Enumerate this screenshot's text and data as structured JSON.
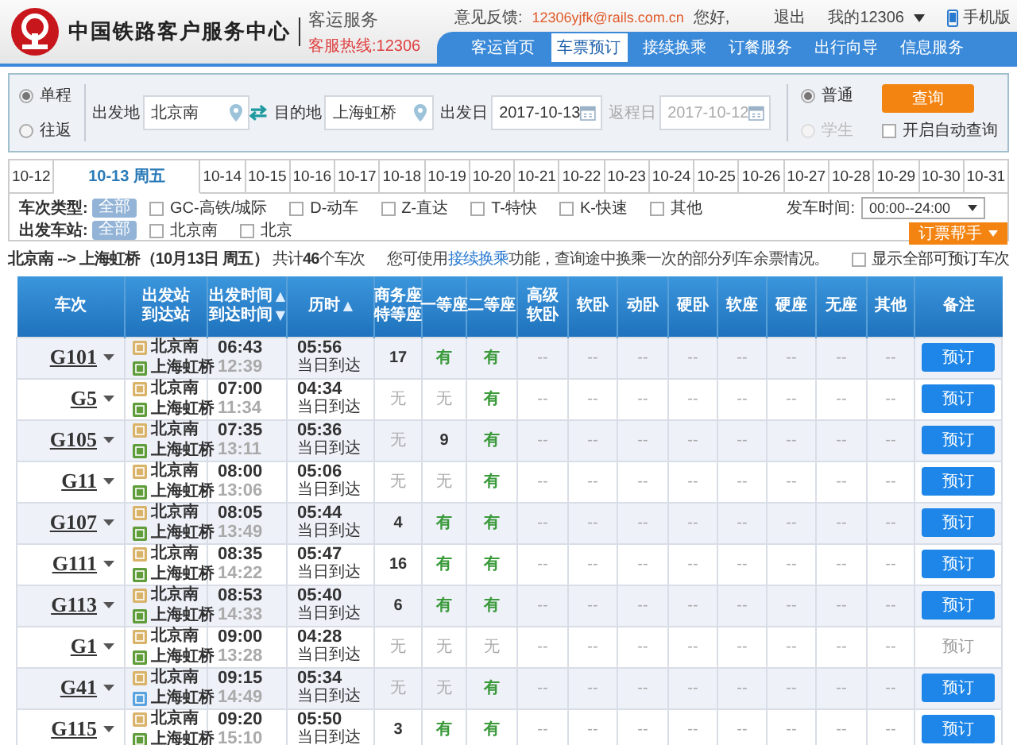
{
  "header": {
    "title": "中国铁路客户服务中心",
    "subtitle": "客运服务",
    "hotline": "客服热线:12306",
    "feedback_label": "意见反馈:",
    "feedback_email": "12306yjfk@rails.com.cn",
    "greeting": "您好,",
    "logout": "退出",
    "my_account": "我的12306",
    "mobile": "手机版",
    "nav": [
      {
        "label": "客运首页",
        "selected": false
      },
      {
        "label": "车票预订",
        "selected": true
      },
      {
        "label": "接续换乘",
        "selected": false
      },
      {
        "label": "订餐服务",
        "selected": false
      },
      {
        "label": "出行向导",
        "selected": false
      },
      {
        "label": "信息服务",
        "selected": false
      }
    ]
  },
  "search": {
    "trip_types": [
      {
        "label": "单程",
        "selected": true
      },
      {
        "label": "往返",
        "selected": false
      }
    ],
    "from": {
      "label": "出发地",
      "value": "北京南"
    },
    "to": {
      "label": "目的地",
      "value": "上海虹桥"
    },
    "depart_date": {
      "label": "出发日",
      "value": "2017-10-13",
      "disabled": false
    },
    "return_date": {
      "label": "返程日",
      "value": "2017-10-12",
      "disabled": true
    },
    "passenger_types": [
      {
        "label": "普通",
        "selected": true,
        "disabled": false
      },
      {
        "label": "学生",
        "selected": false,
        "disabled": true
      }
    ],
    "query_button": "查询",
    "auto_query": {
      "label": "开启自动查询",
      "checked": false
    }
  },
  "dates": [
    {
      "label": "10-12",
      "selected": false
    },
    {
      "label": "10-13 周五",
      "selected": true
    },
    {
      "label": "10-14",
      "selected": false
    },
    {
      "label": "10-15",
      "selected": false
    },
    {
      "label": "10-16",
      "selected": false
    },
    {
      "label": "10-17",
      "selected": false
    },
    {
      "label": "10-18",
      "selected": false
    },
    {
      "label": "10-19",
      "selected": false
    },
    {
      "label": "10-20",
      "selected": false
    },
    {
      "label": "10-21",
      "selected": false
    },
    {
      "label": "10-22",
      "selected": false
    },
    {
      "label": "10-23",
      "selected": false
    },
    {
      "label": "10-24",
      "selected": false
    },
    {
      "label": "10-25",
      "selected": false
    },
    {
      "label": "10-26",
      "selected": false
    },
    {
      "label": "10-27",
      "selected": false
    },
    {
      "label": "10-28",
      "selected": false
    },
    {
      "label": "10-29",
      "selected": false
    },
    {
      "label": "10-30",
      "selected": false
    },
    {
      "label": "10-31",
      "selected": false
    }
  ],
  "filters": {
    "train_type": {
      "label": "车次类型:",
      "all": {
        "label": "全部",
        "selected": true
      },
      "options": [
        {
          "label": "GC-高铁/城际",
          "checked": false
        },
        {
          "label": "D-动车",
          "checked": false
        },
        {
          "label": "Z-直达",
          "checked": false
        },
        {
          "label": "T-特快",
          "checked": false
        },
        {
          "label": "K-快速",
          "checked": false
        },
        {
          "label": "其他",
          "checked": false
        }
      ]
    },
    "depart_time": {
      "label": "发车时间:",
      "value": "00:00--24:00"
    },
    "station": {
      "label": "出发车站:",
      "all": {
        "label": "全部",
        "selected": true
      },
      "options": [
        {
          "label": "北京南",
          "checked": false
        },
        {
          "label": "北京",
          "checked": false
        }
      ]
    },
    "helper_button": "订票帮手"
  },
  "summary": {
    "route": "**北京南 --> 上海虹桥（10月13日  周五）** 共计**46**个车次",
    "notice_before": "您可使用",
    "notice_link": "接续换乘",
    "notice_after": "功能，查询途中换乘一次的部分列车余票情况。",
    "show_all": {
      "label": "显示全部可预订车次",
      "checked": false
    }
  },
  "table": {
    "columns": [
      {
        "lines": [
          {
            "text": "车次"
          }
        ]
      },
      {
        "lines": [
          {
            "text": "出发站"
          },
          {
            "text": "到达站"
          }
        ]
      },
      {
        "lines": [
          {
            "text": "出发时间",
            "sort": "▲"
          },
          {
            "text": "到达时间",
            "sort": "▼"
          }
        ]
      },
      {
        "lines": [
          {
            "text": "历时",
            "sort": "▲"
          }
        ]
      },
      {
        "lines": [
          {
            "text": "商务座"
          },
          {
            "text": "特等座"
          }
        ]
      },
      {
        "lines": [
          {
            "text": "一等座"
          }
        ]
      },
      {
        "lines": [
          {
            "text": "二等座"
          }
        ]
      },
      {
        "lines": [
          {
            "text": "高级"
          },
          {
            "text": "软卧"
          }
        ]
      },
      {
        "lines": [
          {
            "text": "软卧"
          }
        ]
      },
      {
        "lines": [
          {
            "text": "动卧"
          }
        ]
      },
      {
        "lines": [
          {
            "text": "硬卧"
          }
        ]
      },
      {
        "lines": [
          {
            "text": "软座"
          }
        ]
      },
      {
        "lines": [
          {
            "text": "硬座"
          }
        ]
      },
      {
        "lines": [
          {
            "text": "无座"
          }
        ]
      },
      {
        "lines": [
          {
            "text": "其他"
          }
        ]
      },
      {
        "lines": [
          {
            "text": "备注"
          }
        ]
      }
    ],
    "rows": [
      {
        "train": "G101",
        "from": {
          "name": "北京南",
          "kind": "start"
        },
        "to": {
          "name": "上海虹桥",
          "kind": "end"
        },
        "depart": "06:43",
        "arrive": "12:39",
        "duration": "05:56",
        "arrival_day": "当日到达",
        "seats": [
          {
            "text": "17",
            "kind": "count"
          },
          {
            "text": "有",
            "kind": "yes"
          },
          {
            "text": "有",
            "kind": "yes"
          },
          {
            "text": "--",
            "kind": "na"
          },
          {
            "text": "--",
            "kind": "na"
          },
          {
            "text": "--",
            "kind": "na"
          },
          {
            "text": "--",
            "kind": "na"
          },
          {
            "text": "--",
            "kind": "na"
          },
          {
            "text": "--",
            "kind": "na"
          },
          {
            "text": "--",
            "kind": "na"
          },
          {
            "text": "--",
            "kind": "na"
          }
        ],
        "book": {
          "label": "预订",
          "disabled": false
        }
      },
      {
        "train": "G5",
        "from": {
          "name": "北京南",
          "kind": "start"
        },
        "to": {
          "name": "上海虹桥",
          "kind": "end"
        },
        "depart": "07:00",
        "arrive": "11:34",
        "duration": "04:34",
        "arrival_day": "当日到达",
        "seats": [
          {
            "text": "无",
            "kind": "no"
          },
          {
            "text": "无",
            "kind": "no"
          },
          {
            "text": "有",
            "kind": "yes"
          },
          {
            "text": "--",
            "kind": "na"
          },
          {
            "text": "--",
            "kind": "na"
          },
          {
            "text": "--",
            "kind": "na"
          },
          {
            "text": "--",
            "kind": "na"
          },
          {
            "text": "--",
            "kind": "na"
          },
          {
            "text": "--",
            "kind": "na"
          },
          {
            "text": "--",
            "kind": "na"
          },
          {
            "text": "--",
            "kind": "na"
          }
        ],
        "book": {
          "label": "预订",
          "disabled": false
        }
      },
      {
        "train": "G105",
        "from": {
          "name": "北京南",
          "kind": "start"
        },
        "to": {
          "name": "上海虹桥",
          "kind": "end"
        },
        "depart": "07:35",
        "arrive": "13:11",
        "duration": "05:36",
        "arrival_day": "当日到达",
        "seats": [
          {
            "text": "无",
            "kind": "no"
          },
          {
            "text": "9",
            "kind": "count"
          },
          {
            "text": "有",
            "kind": "yes"
          },
          {
            "text": "--",
            "kind": "na"
          },
          {
            "text": "--",
            "kind": "na"
          },
          {
            "text": "--",
            "kind": "na"
          },
          {
            "text": "--",
            "kind": "na"
          },
          {
            "text": "--",
            "kind": "na"
          },
          {
            "text": "--",
            "kind": "na"
          },
          {
            "text": "--",
            "kind": "na"
          },
          {
            "text": "--",
            "kind": "na"
          }
        ],
        "book": {
          "label": "预订",
          "disabled": false
        }
      },
      {
        "train": "G11",
        "from": {
          "name": "北京南",
          "kind": "start"
        },
        "to": {
          "name": "上海虹桥",
          "kind": "end"
        },
        "depart": "08:00",
        "arrive": "13:06",
        "duration": "05:06",
        "arrival_day": "当日到达",
        "seats": [
          {
            "text": "无",
            "kind": "no"
          },
          {
            "text": "无",
            "kind": "no"
          },
          {
            "text": "有",
            "kind": "yes"
          },
          {
            "text": "--",
            "kind": "na"
          },
          {
            "text": "--",
            "kind": "na"
          },
          {
            "text": "--",
            "kind": "na"
          },
          {
            "text": "--",
            "kind": "na"
          },
          {
            "text": "--",
            "kind": "na"
          },
          {
            "text": "--",
            "kind": "na"
          },
          {
            "text": "--",
            "kind": "na"
          },
          {
            "text": "--",
            "kind": "na"
          }
        ],
        "book": {
          "label": "预订",
          "disabled": false
        }
      },
      {
        "train": "G107",
        "from": {
          "name": "北京南",
          "kind": "start"
        },
        "to": {
          "name": "上海虹桥",
          "kind": "end"
        },
        "depart": "08:05",
        "arrive": "13:49",
        "duration": "05:44",
        "arrival_day": "当日到达",
        "seats": [
          {
            "text": "4",
            "kind": "count"
          },
          {
            "text": "有",
            "kind": "yes"
          },
          {
            "text": "有",
            "kind": "yes"
          },
          {
            "text": "--",
            "kind": "na"
          },
          {
            "text": "--",
            "kind": "na"
          },
          {
            "text": "--",
            "kind": "na"
          },
          {
            "text": "--",
            "kind": "na"
          },
          {
            "text": "--",
            "kind": "na"
          },
          {
            "text": "--",
            "kind": "na"
          },
          {
            "text": "--",
            "kind": "na"
          },
          {
            "text": "--",
            "kind": "na"
          }
        ],
        "book": {
          "label": "预订",
          "disabled": false
        }
      },
      {
        "train": "G111",
        "from": {
          "name": "北京南",
          "kind": "start"
        },
        "to": {
          "name": "上海虹桥",
          "kind": "end"
        },
        "depart": "08:35",
        "arrive": "14:22",
        "duration": "05:47",
        "arrival_day": "当日到达",
        "seats": [
          {
            "text": "16",
            "kind": "count"
          },
          {
            "text": "有",
            "kind": "yes"
          },
          {
            "text": "有",
            "kind": "yes"
          },
          {
            "text": "--",
            "kind": "na"
          },
          {
            "text": "--",
            "kind": "na"
          },
          {
            "text": "--",
            "kind": "na"
          },
          {
            "text": "--",
            "kind": "na"
          },
          {
            "text": "--",
            "kind": "na"
          },
          {
            "text": "--",
            "kind": "na"
          },
          {
            "text": "--",
            "kind": "na"
          },
          {
            "text": "--",
            "kind": "na"
          }
        ],
        "book": {
          "label": "预订",
          "disabled": false
        }
      },
      {
        "train": "G113",
        "from": {
          "name": "北京南",
          "kind": "start"
        },
        "to": {
          "name": "上海虹桥",
          "kind": "end"
        },
        "depart": "08:53",
        "arrive": "14:33",
        "duration": "05:40",
        "arrival_day": "当日到达",
        "seats": [
          {
            "text": "6",
            "kind": "count"
          },
          {
            "text": "有",
            "kind": "yes"
          },
          {
            "text": "有",
            "kind": "yes"
          },
          {
            "text": "--",
            "kind": "na"
          },
          {
            "text": "--",
            "kind": "na"
          },
          {
            "text": "--",
            "kind": "na"
          },
          {
            "text": "--",
            "kind": "na"
          },
          {
            "text": "--",
            "kind": "na"
          },
          {
            "text": "--",
            "kind": "na"
          },
          {
            "text": "--",
            "kind": "na"
          },
          {
            "text": "--",
            "kind": "na"
          }
        ],
        "book": {
          "label": "预订",
          "disabled": false
        }
      },
      {
        "train": "G1",
        "from": {
          "name": "北京南",
          "kind": "start"
        },
        "to": {
          "name": "上海虹桥",
          "kind": "end"
        },
        "depart": "09:00",
        "arrive": "13:28",
        "duration": "04:28",
        "arrival_day": "当日到达",
        "seats": [
          {
            "text": "无",
            "kind": "no"
          },
          {
            "text": "无",
            "kind": "no"
          },
          {
            "text": "无",
            "kind": "no"
          },
          {
            "text": "--",
            "kind": "na"
          },
          {
            "text": "--",
            "kind": "na"
          },
          {
            "text": "--",
            "kind": "na"
          },
          {
            "text": "--",
            "kind": "na"
          },
          {
            "text": "--",
            "kind": "na"
          },
          {
            "text": "--",
            "kind": "na"
          },
          {
            "text": "--",
            "kind": "na"
          },
          {
            "text": "--",
            "kind": "na"
          }
        ],
        "book": {
          "label": "预订",
          "disabled": true
        }
      },
      {
        "train": "G41",
        "from": {
          "name": "北京南",
          "kind": "start"
        },
        "to": {
          "name": "上海虹桥",
          "kind": "pass"
        },
        "depart": "09:15",
        "arrive": "14:49",
        "duration": "05:34",
        "arrival_day": "当日到达",
        "seats": [
          {
            "text": "无",
            "kind": "no"
          },
          {
            "text": "无",
            "kind": "no"
          },
          {
            "text": "有",
            "kind": "yes"
          },
          {
            "text": "--",
            "kind": "na"
          },
          {
            "text": "--",
            "kind": "na"
          },
          {
            "text": "--",
            "kind": "na"
          },
          {
            "text": "--",
            "kind": "na"
          },
          {
            "text": "--",
            "kind": "na"
          },
          {
            "text": "--",
            "kind": "na"
          },
          {
            "text": "--",
            "kind": "na"
          },
          {
            "text": "--",
            "kind": "na"
          }
        ],
        "book": {
          "label": "预订",
          "disabled": false
        }
      },
      {
        "train": "G115",
        "from": {
          "name": "北京南",
          "kind": "start"
        },
        "to": {
          "name": "上海虹桥",
          "kind": "end"
        },
        "depart": "09:20",
        "arrive": "15:10",
        "duration": "05:50",
        "arrival_day": "当日到达",
        "seats": [
          {
            "text": "3",
            "kind": "count"
          },
          {
            "text": "有",
            "kind": "yes"
          },
          {
            "text": "有",
            "kind": "yes"
          },
          {
            "text": "--",
            "kind": "na"
          },
          {
            "text": "--",
            "kind": "na"
          },
          {
            "text": "--",
            "kind": "na"
          },
          {
            "text": "--",
            "kind": "na"
          },
          {
            "text": "--",
            "kind": "na"
          },
          {
            "text": "--",
            "kind": "na"
          },
          {
            "text": "--",
            "kind": "na"
          },
          {
            "text": "--",
            "kind": "na"
          }
        ],
        "book": {
          "label": "预订",
          "disabled": false
        }
      }
    ]
  }
}
